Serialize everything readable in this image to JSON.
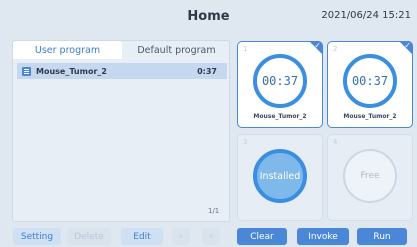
{
  "header": {
    "title": "Home",
    "datetime": "2021/06/24 15:21"
  },
  "program_panel": {
    "tabs": [
      {
        "label": "User program",
        "active": true
      },
      {
        "label": "Default program",
        "active": false
      }
    ],
    "programs": [
      {
        "name": "Mouse_Tumor_2",
        "duration": "0:37",
        "selected": true
      }
    ],
    "page_indicator": "1/1"
  },
  "slots": [
    {
      "number": "1",
      "state": "running",
      "display": "00:37",
      "program": "Mouse_Tumor_2",
      "checked": true
    },
    {
      "number": "2",
      "state": "running",
      "display": "00:37",
      "program": "Mouse_Tumor_2",
      "checked": true
    },
    {
      "number": "3",
      "state": "installed",
      "display": "Installed",
      "checked": false
    },
    {
      "number": "4",
      "state": "free",
      "display": "Free",
      "checked": false
    }
  ],
  "toolbar": {
    "setting": "Setting",
    "delete": "Delete",
    "edit": "Edit",
    "prev_icon": "chevron-left-icon",
    "next_icon": "chevron-right-icon",
    "clear": "Clear",
    "invoke": "Invoke",
    "run": "Run"
  },
  "colors": {
    "accent": "#4a87d6",
    "ring": "#3a8fe0",
    "background": "#dfe7f1",
    "installed_fill": "#7fb8ea"
  }
}
